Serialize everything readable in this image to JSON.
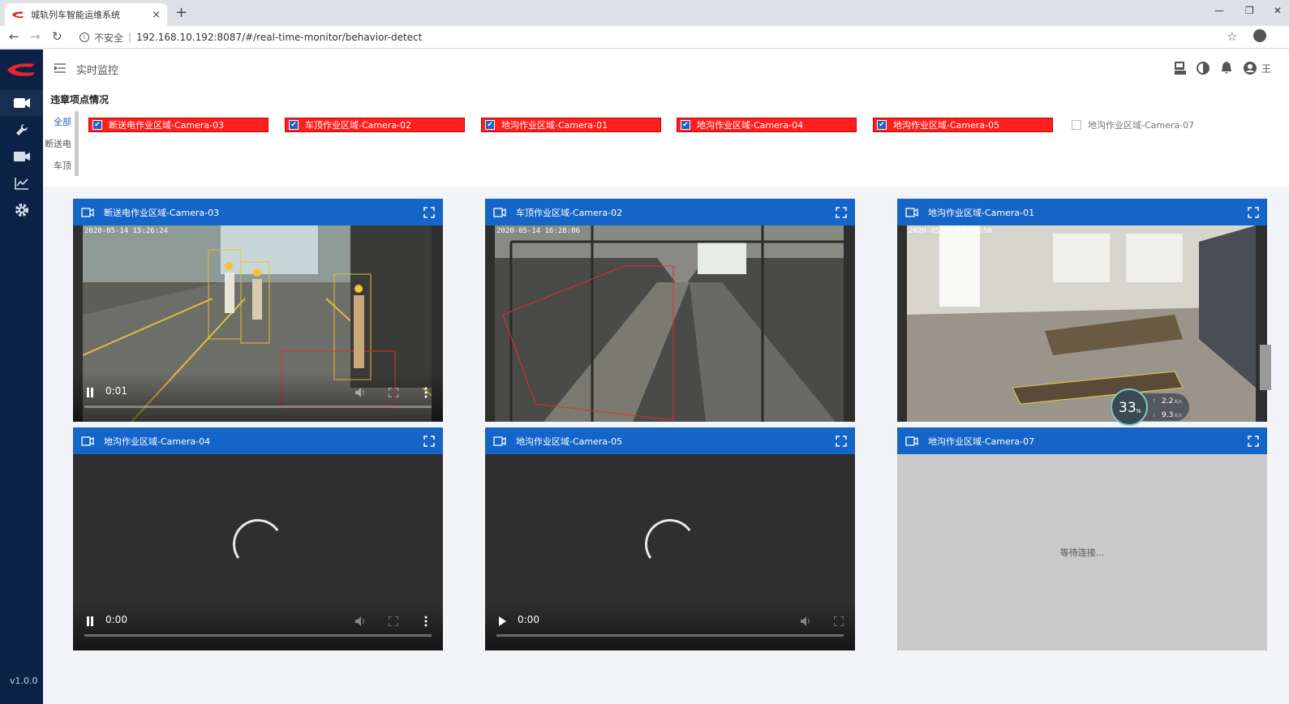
{
  "browser": {
    "tab_title": "城轨列车智能运维系统",
    "new_tab": "+",
    "tab_close": "×",
    "security_label": "不安全",
    "url": "192.168.10.192:8087/#/real-time-monitor/behavior-detect",
    "window_controls": [
      "—",
      "❐",
      "✕"
    ]
  },
  "app": {
    "version": "v1.0.0",
    "header_title": "实时监控",
    "user_label": "王",
    "sidebar_icons": [
      "camera-icon",
      "wrench-icon",
      "video-icon",
      "chart-icon",
      "gear-icon"
    ],
    "brand_color": "#1565c8",
    "sidebar_color": "#0b2145",
    "alert_color": "#ff1f1f"
  },
  "filter": {
    "section_title": "违章项点情况",
    "categories": [
      "全部",
      "断送电",
      "车顶"
    ],
    "cameras": [
      {
        "label": "断送电作业区域-Camera-03",
        "checked": true
      },
      {
        "label": "车顶作业区域-Camera-02",
        "checked": true
      },
      {
        "label": "地沟作业区域-Camera-01",
        "checked": true
      },
      {
        "label": "地沟作业区域-Camera-04",
        "checked": true
      },
      {
        "label": "地沟作业区域-Camera-05",
        "checked": true
      },
      {
        "label": "地沟作业区域-Camera-07",
        "checked": false
      }
    ]
  },
  "feeds": [
    {
      "title": "断送电作业区域-Camera-03",
      "timestamp": "2020-05-14 15:26:24",
      "time": "0:01",
      "state": "playing"
    },
    {
      "title": "车顶作业区域-Camera-02",
      "timestamp": "2020-05-14 16:28:06",
      "state": "playing"
    },
    {
      "title": "地沟作业区域-Camera-01",
      "timestamp": "2020-05-14 16:25:50",
      "state": "playing"
    },
    {
      "title": "地沟作业区域-Camera-04",
      "time": "0:00",
      "state": "loading"
    },
    {
      "title": "地沟作业区域-Camera-05",
      "time": "0:00",
      "state": "loading"
    },
    {
      "title": "地沟作业区域-Camera-07",
      "waiting_text": "等待连接...",
      "state": "waiting"
    }
  ],
  "speed_widget": {
    "percent": "33",
    "percent_unit": "%",
    "upload": "2.2",
    "download": "9.3",
    "unit": "K/s"
  }
}
